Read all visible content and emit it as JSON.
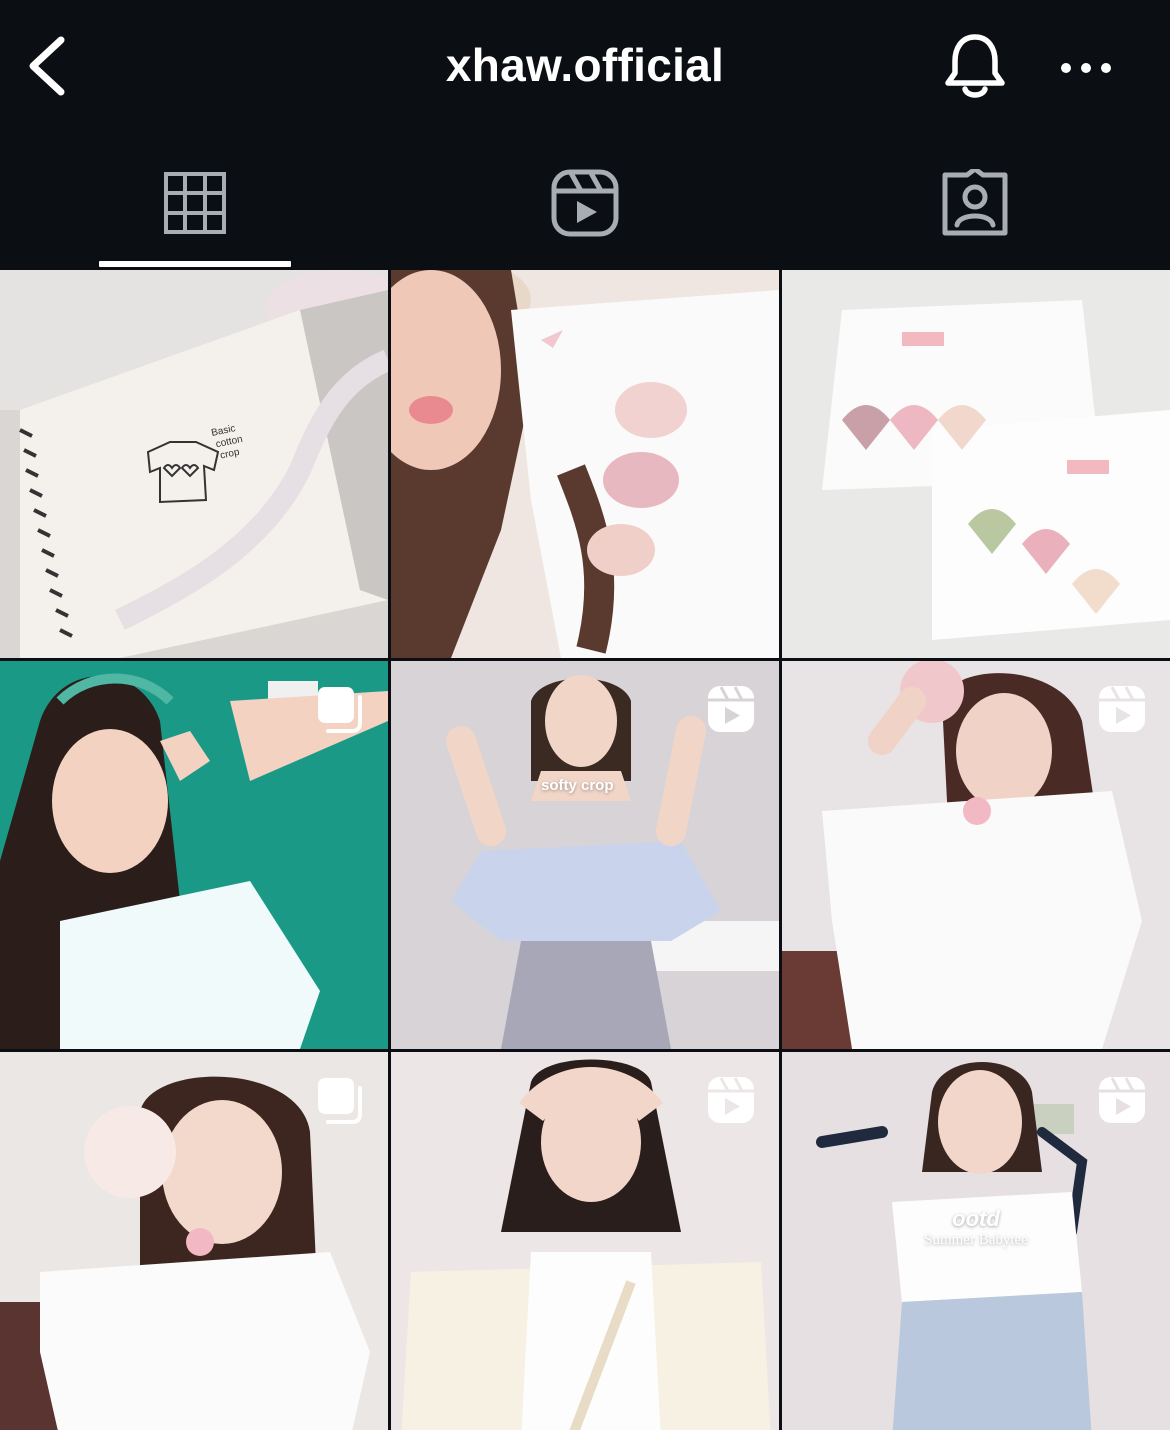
{
  "header": {
    "username": "xhaw.official",
    "back_icon": "chevron-left-icon",
    "bell_icon": "bell-icon",
    "more_icon": "more-horizontal-icon"
  },
  "tabs": [
    {
      "name": "posts",
      "icon": "grid-icon",
      "active": true
    },
    {
      "name": "reels",
      "icon": "reels-icon",
      "active": false
    },
    {
      "name": "tagged",
      "icon": "tagged-person-icon",
      "active": false
    }
  ],
  "grid": {
    "posts": [
      {
        "type": "photo",
        "badge": null,
        "sketch_text": [
          "Basic",
          "cotton",
          "crop"
        ]
      },
      {
        "type": "photo",
        "badge": null
      },
      {
        "type": "photo",
        "badge": null
      },
      {
        "type": "carousel",
        "badge": "carousel-icon"
      },
      {
        "type": "reel",
        "badge": "reels-icon",
        "overlay_text": "softy crop"
      },
      {
        "type": "reel",
        "badge": "reels-icon"
      },
      {
        "type": "carousel",
        "badge": "carousel-icon"
      },
      {
        "type": "reel",
        "badge": "reels-icon"
      },
      {
        "type": "reel",
        "badge": "reels-icon",
        "overlay_title": "ootd",
        "overlay_subtitle": "Summer Babytee"
      }
    ]
  },
  "colors": {
    "background": "#0b0f14",
    "icon": "#a8adb3",
    "active_indicator": "#ffffff"
  }
}
